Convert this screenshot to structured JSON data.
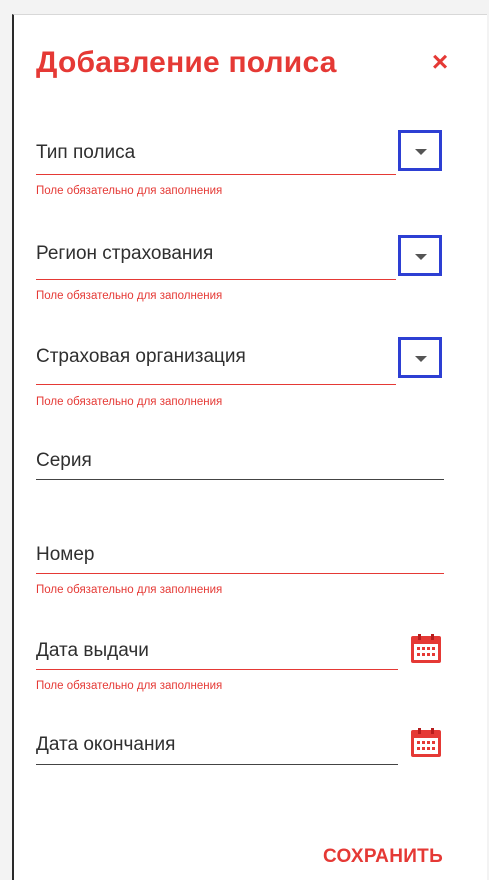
{
  "dialog": {
    "title": "Добавление полиса",
    "close_glyph": "×",
    "save_label": "СОХРАНИТЬ"
  },
  "fields": {
    "policy_type": {
      "label": "Тип полиса",
      "error": "Поле обязательно для заполнения",
      "control": "dropdown",
      "icon": "chevron-down-icon"
    },
    "region": {
      "label": "Регион страхования",
      "error": "Поле обязательно для заполнения",
      "control": "dropdown",
      "icon": "chevron-down-icon"
    },
    "insurer": {
      "label": "Страховая организация",
      "error": "Поле обязательно для заполнения",
      "control": "dropdown",
      "icon": "chevron-down-icon"
    },
    "series": {
      "label": "Серия"
    },
    "number": {
      "label": "Номер",
      "error": "Поле обязательно для заполнения"
    },
    "issue_date": {
      "label": "Дата выдачи",
      "error": "Поле обязательно для заполнения",
      "icon": "calendar-icon"
    },
    "end_date": {
      "label": "Дата окончания",
      "icon": "calendar-icon"
    }
  },
  "colors": {
    "accent": "#e53935",
    "highlight": "#2d3fd3",
    "text": "#2f2f2f"
  }
}
